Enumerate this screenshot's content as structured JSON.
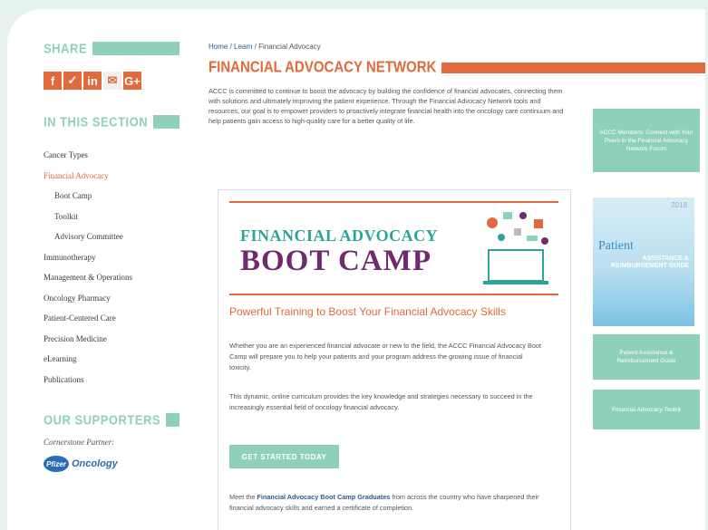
{
  "sidebar": {
    "share_heading": "SHARE",
    "social": [
      {
        "icon": "facebook-icon",
        "glyph": "f"
      },
      {
        "icon": "twitter-icon",
        "glyph": "✓"
      },
      {
        "icon": "linkedin-icon",
        "glyph": "in"
      },
      {
        "icon": "email-icon",
        "glyph": "✉"
      },
      {
        "icon": "google-plus-icon",
        "glyph": "G+"
      }
    ],
    "section_heading": "IN THIS SECTION",
    "nav": [
      {
        "label": "Cancer Types",
        "type": "item"
      },
      {
        "label": "Financial Advocacy",
        "type": "active"
      },
      {
        "label": "Boot Camp",
        "type": "sub"
      },
      {
        "label": "Toolkit",
        "type": "sub"
      },
      {
        "label": "Advisory Committee",
        "type": "sub"
      },
      {
        "label": "Immunotherapy",
        "type": "item"
      },
      {
        "label": "Management & Operations",
        "type": "item"
      },
      {
        "label": "Oncology Pharmacy",
        "type": "item"
      },
      {
        "label": "Patient-Centered Care",
        "type": "item"
      },
      {
        "label": "Precision Medicine",
        "type": "item"
      },
      {
        "label": "eLearning",
        "type": "item"
      },
      {
        "label": "Publications",
        "type": "item"
      }
    ],
    "supporters_heading": "OUR SUPPORTERS",
    "supporter_label": "Cornerstone Partner:",
    "supporter_logo": "Pfizer",
    "supporter_name": "Oncology"
  },
  "breadcrumb": {
    "home": "Home",
    "sep": " / ",
    "learn": "Learn",
    "current": "Financial Advocacy"
  },
  "page_title": "FINANCIAL ADVOCACY NETWORK",
  "intro": "ACCC is committed to continue to boost the advocacy by building the confidence of financial advocates, connecting them with solutions and ultimately improving the patient experience. Through the Financial Advocacy Network tools and resources, our goal is to empower providers to proactively integrate financial health into the oncology care continuum and help patients gain access to high-quality care for a better quality of life.",
  "card": {
    "banner_line1": "FINANCIAL ADVOCACY",
    "banner_line2": "BOOT CAMP",
    "heading": "Powerful Training to Boost Your Financial Advocacy Skills",
    "p1": "Whether you are an experienced financial advocate or new to the field, the ACCC Financial Advocacy Boot Camp will prepare you to help your patients and your program address the growing issue of financial toxicity.",
    "p2": "This dynamic, online curriculum provides the key knowledge and strategies necessary to succeed in the increasingly essential field of oncology financial advocacy.",
    "cta": "GET STARTED TODAY",
    "p3_pre": "Meet the ",
    "p3_link": "Financial Advocacy Boot Camp Graduates",
    "p3_post": " from across the country who have sharpened their financial advocacy skills and earned a certificate of completion."
  },
  "right": {
    "box1": "ACCC Members: Connect with Your Peers in the Financial Advocacy Network Forum",
    "guide_year": "2018",
    "guide_title": "Patient",
    "guide_sub": "ASSISTANCE & REIMBURSEMENT GUIDE",
    "box2": "Patient Assistance & Reimbursement Guide",
    "box3": "Financial Advocacy Toolkit"
  },
  "colors": {
    "accent": "#e06a3c",
    "teal": "#8fd0bd",
    "purple": "#6e2b6f"
  }
}
